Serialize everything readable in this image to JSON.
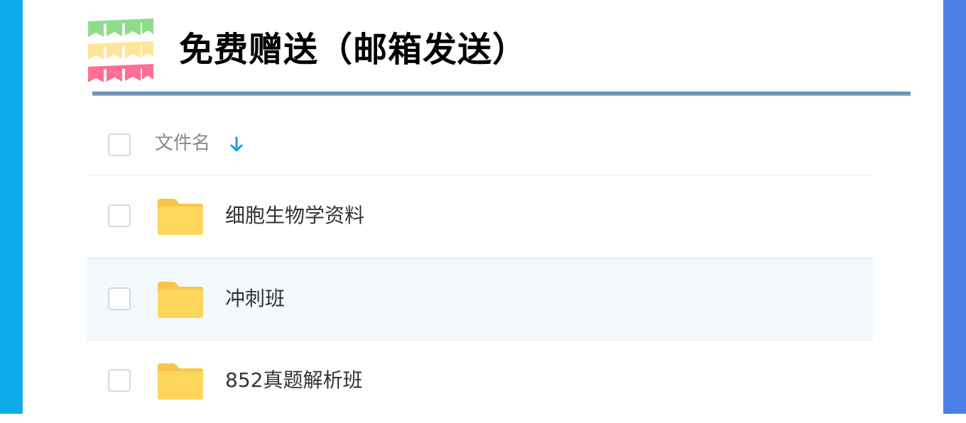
{
  "colors": {
    "left_bar": "#0daaea",
    "right_bar": "#4a80e6",
    "title_rule": "#5a96c8",
    "folder": "#ffd65c",
    "sort_arrow": "#1a9be6",
    "selected_row": "#f3f9fd"
  },
  "header": {
    "title": "免费赠送（邮箱发送）",
    "decoration_icon": "bunting-flags-icon"
  },
  "file_list": {
    "column_name_label": "文件名",
    "sort_icon": "arrow-down-icon",
    "select_all_checked": false,
    "items": [
      {
        "name": "细胞生物学资料",
        "type": "folder",
        "icon": "folder-icon",
        "checked": false,
        "highlighted": false
      },
      {
        "name": "冲刺班",
        "type": "folder",
        "icon": "folder-icon",
        "checked": false,
        "highlighted": true
      },
      {
        "name": "852真题解析班",
        "type": "folder",
        "icon": "folder-icon",
        "checked": false,
        "highlighted": false
      }
    ]
  }
}
